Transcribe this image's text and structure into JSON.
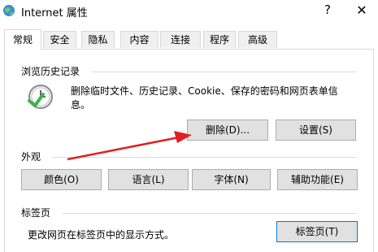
{
  "window": {
    "title": "Internet 属性",
    "help_label": "?",
    "close_label": "✕"
  },
  "tabs": [
    {
      "label": "常规"
    },
    {
      "label": "安全"
    },
    {
      "label": "隐私"
    },
    {
      "label": "内容"
    },
    {
      "label": "连接"
    },
    {
      "label": "程序"
    },
    {
      "label": "高级"
    }
  ],
  "history": {
    "title": "浏览历史记录",
    "desc_line1": "删除临时文件、历史记录、Cookie、保存的密码和网页表单信",
    "desc_line2": "息。",
    "delete_label": "删除(D)...",
    "settings_label": "设置(S)",
    "icon": "history-clock-icon"
  },
  "appearance": {
    "title": "外观",
    "colors_label": "颜色(O)",
    "languages_label": "语言(L)",
    "fonts_label": "字体(N)",
    "accessibility_label": "辅助功能(E)"
  },
  "tabs_section": {
    "title": "标签页",
    "desc": "更改网页在标签页中的显示方式。",
    "tabs_label": "标签页(T)"
  },
  "colors": {
    "annotation_arrow": "#e02020",
    "button_bg": "#e1e1e1",
    "button_border": "#adadad"
  }
}
